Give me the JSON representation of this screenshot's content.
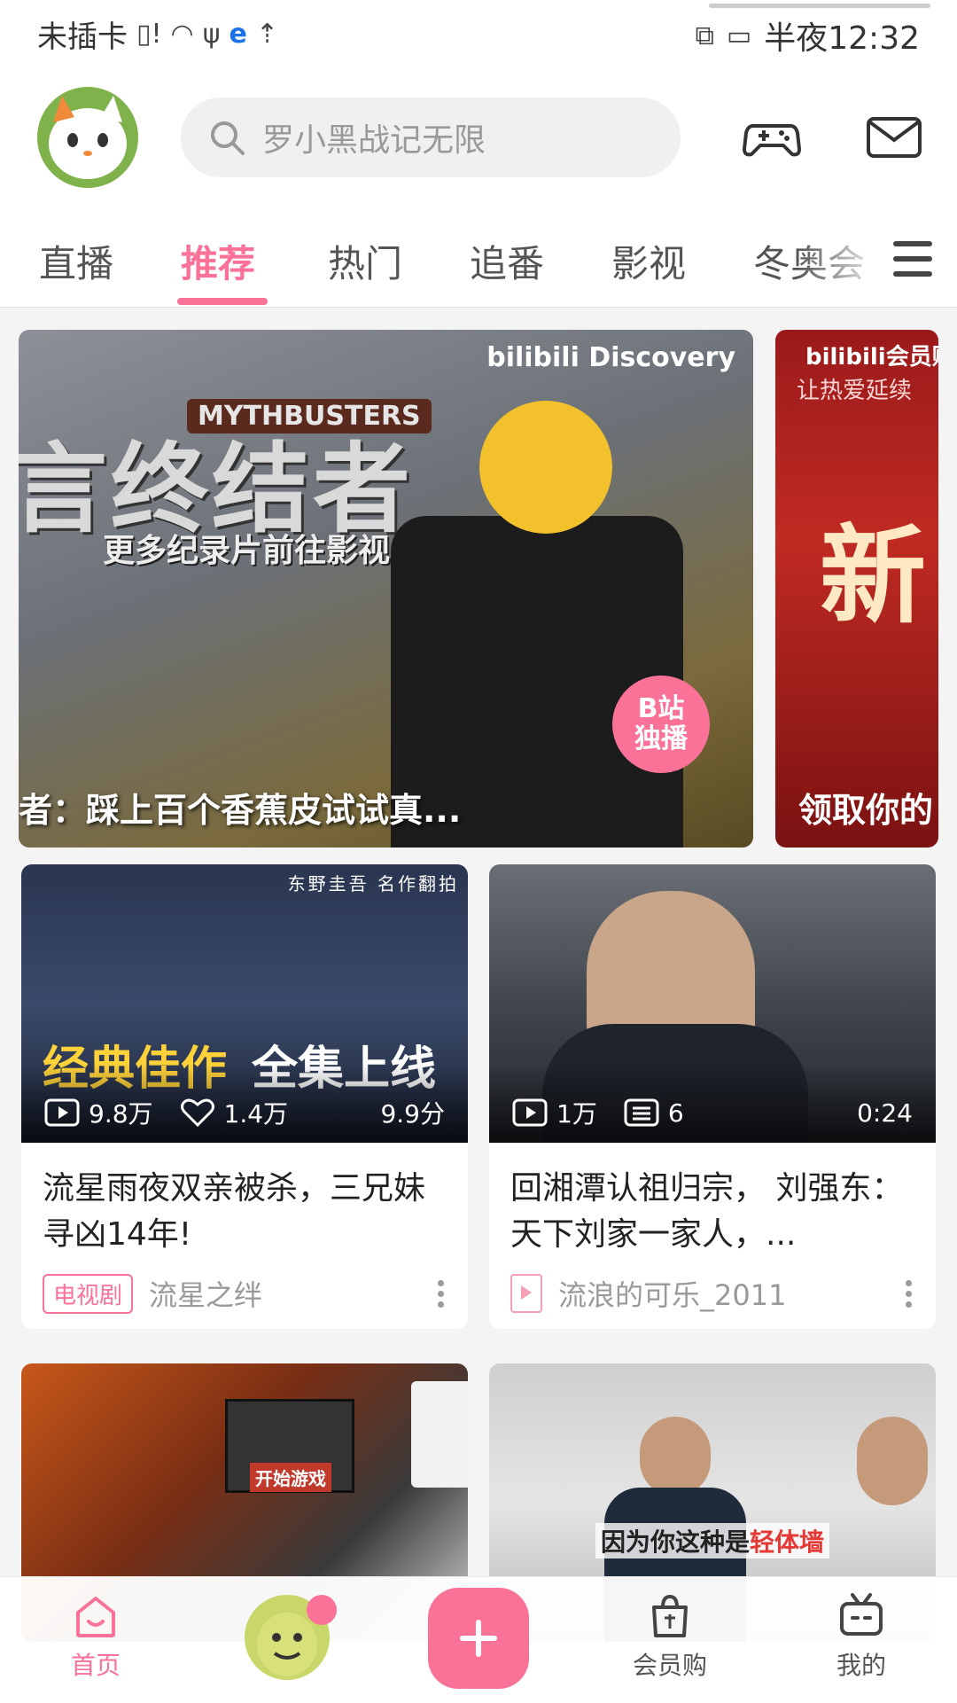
{
  "status_bar": {
    "carrier": "未插卡",
    "time": "半夜12:32"
  },
  "header": {
    "search_placeholder": "罗小黑战记无限"
  },
  "tabs": [
    {
      "label": "直播"
    },
    {
      "label": "推荐"
    },
    {
      "label": "热门"
    },
    {
      "label": "追番"
    },
    {
      "label": "影视"
    },
    {
      "label": "冬奥会"
    }
  ],
  "active_tab": "推荐",
  "banner": {
    "caption": "者：踩上百个香蕉皮试试真...",
    "big_text": "言终结者",
    "show_badge": "MYTHBUSTERS",
    "subtitle": "更多纪录片前往影视",
    "logos": "bilibili  Discovery",
    "exclusive_line1": "B站",
    "exclusive_line2": "独播"
  },
  "banner2": {
    "line1": "bilibili会员购",
    "line2": "让热爱延续",
    "big": "新",
    "caption": "领取你的"
  },
  "cards": [
    {
      "overlay_top": "东野圭吾 名作翻拍",
      "overlay_main_yellow": "经典佳作",
      "overlay_main_white": "全集上线",
      "views": "9.8万",
      "likes": "1.4万",
      "score": "9.9分",
      "title": "流星雨夜双亲被杀，三兄妹寻凶14年!",
      "tag": "电视剧",
      "source": "流星之绊"
    },
    {
      "views": "1万",
      "comments": "6",
      "duration": "0:24",
      "title": "回湘潭认祖归宗， 刘强东：天下刘家一家人，...",
      "source": "流浪的可乐_2011"
    },
    {
      "overlay_text": "开始游戏"
    },
    {
      "subtitle_white": "因为你这种是",
      "subtitle_red": "轻体墙"
    }
  ],
  "bottom_nav": {
    "home": "首页",
    "mall": "会员购",
    "mine": "我的"
  },
  "colors": {
    "accent": "#fb7299",
    "text": "#222222",
    "muted": "#999999",
    "background": "#f4f4f4"
  }
}
